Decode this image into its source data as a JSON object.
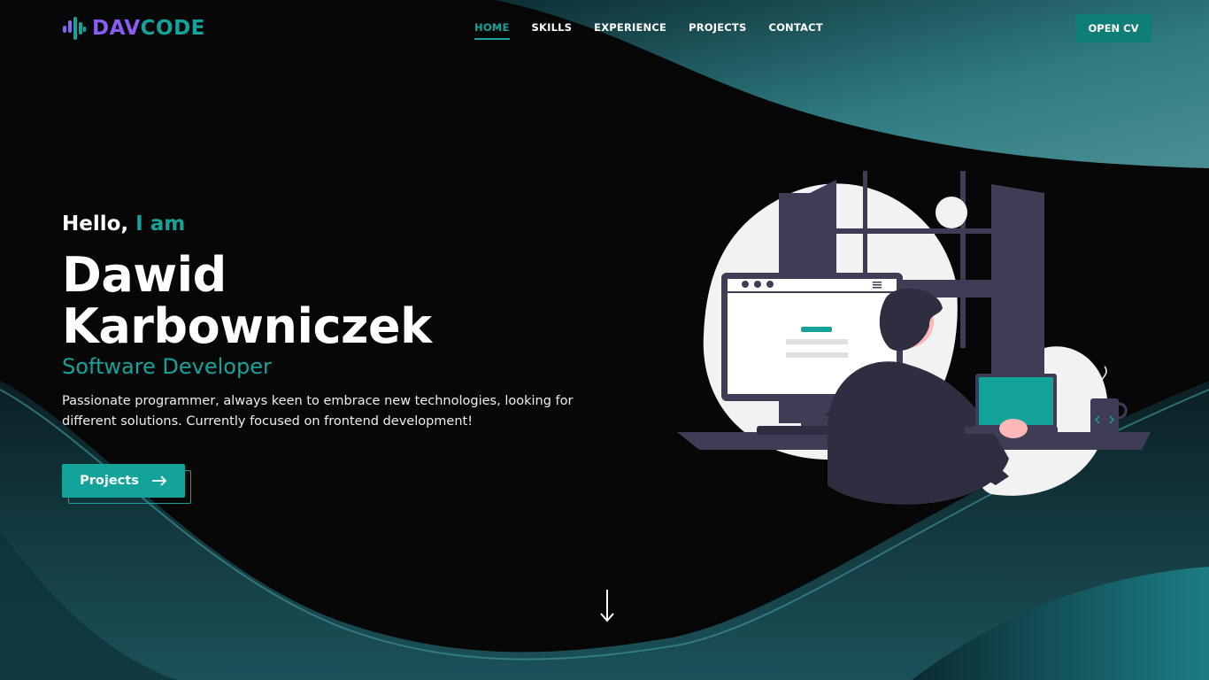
{
  "brand": {
    "part1": "DAV",
    "part2": "CODE"
  },
  "nav": {
    "items": [
      {
        "label": "HOME",
        "active": true
      },
      {
        "label": "SKILLS",
        "active": false
      },
      {
        "label": "EXPERIENCE",
        "active": false
      },
      {
        "label": "PROJECTS",
        "active": false
      },
      {
        "label": "CONTACT",
        "active": false
      }
    ]
  },
  "header": {
    "cv_label": "OPEN CV"
  },
  "hero": {
    "greeting": "Hello,",
    "greeting_accent": "I am",
    "name_line1": "Dawid",
    "name_line2": "Karbowniczek",
    "role": "Software Developer",
    "description": "Passionate programmer, always keen to embrace new technologies, looking for different solutions. Currently focused on frontend development!",
    "button_label": "Projects"
  },
  "icons": {
    "logo": "code-bars-icon",
    "button": "arrow-right-icon",
    "scroll": "arrow-down-icon"
  },
  "colors": {
    "accent": "#14a39a",
    "accent_dark": "#0f7e76",
    "brand_purple": "#8b5cf6",
    "background": "#070707"
  }
}
